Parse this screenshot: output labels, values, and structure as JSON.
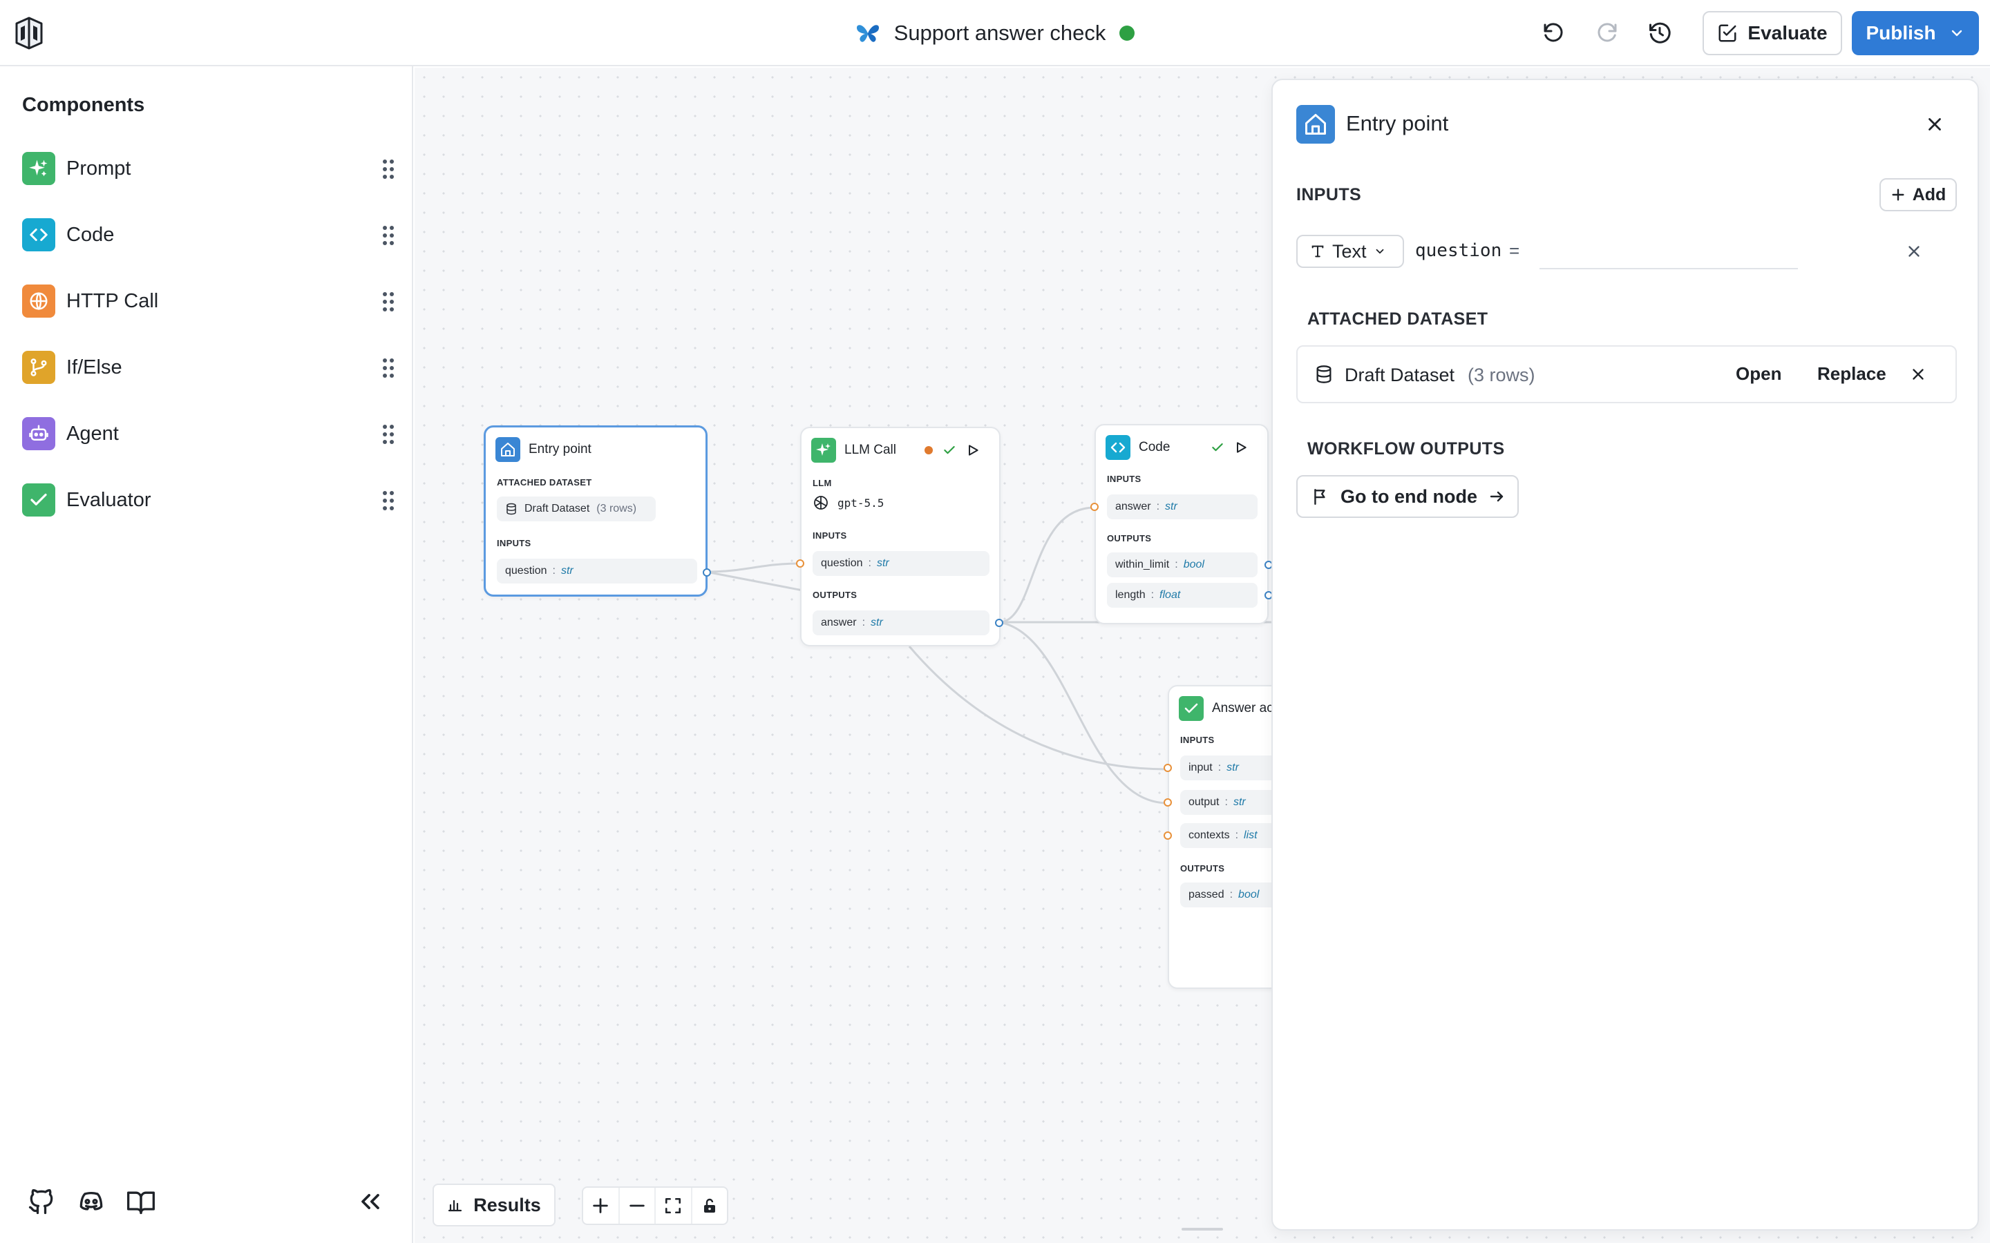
{
  "header": {
    "title": "Support answer check",
    "status_color": "#2ea043",
    "evaluate_label": "Evaluate",
    "publish_label": "Publish",
    "icons": [
      "undo-icon",
      "redo-icon",
      "history-icon",
      "logo-icon",
      "butterfly-icon"
    ]
  },
  "sidebar": {
    "title": "Components",
    "items": [
      {
        "label": "Prompt",
        "icon": "sparkles-icon",
        "color": "#3fb56b"
      },
      {
        "label": "Code",
        "icon": "code-icon",
        "color": "#17a9d1"
      },
      {
        "label": "HTTP Call",
        "icon": "globe-icon",
        "color": "#f08a3c"
      },
      {
        "label": "If/Else",
        "icon": "branch-icon",
        "color": "#e0a42a"
      },
      {
        "label": "Agent",
        "icon": "bot-icon",
        "color": "#8f6ee0"
      },
      {
        "label": "Evaluator",
        "icon": "check-icon",
        "color": "#3fb56b"
      }
    ],
    "footer_icons": [
      "github-icon",
      "discord-icon",
      "book-icon",
      "collapse-icon"
    ]
  },
  "canvas": {
    "nodes": {
      "entry": {
        "title": "Entry point",
        "dataset_label": "ATTACHED DATASET",
        "dataset_name": "Draft Dataset",
        "dataset_rows": "(3 rows)",
        "inputs_label": "INPUTS",
        "input_name": "question",
        "input_type": "str"
      },
      "llm": {
        "title": "LLM Call",
        "llm_label": "LLM",
        "model": "gpt-5.5",
        "inputs_label": "INPUTS",
        "input_name": "question",
        "input_type": "str",
        "outputs_label": "OUTPUTS",
        "output_name": "answer",
        "output_type": "str"
      },
      "code": {
        "title": "Code",
        "inputs_label": "INPUTS",
        "input_name": "answer",
        "input_type": "str",
        "outputs_label": "OUTPUTS",
        "outputs": [
          {
            "name": "within_limit",
            "type": "bool"
          },
          {
            "name": "length",
            "type": "float"
          }
        ]
      },
      "evaluator": {
        "title": "Answer ac",
        "inputs_label": "INPUTS",
        "inputs": [
          {
            "name": "input",
            "type": "str"
          },
          {
            "name": "output",
            "type": "str"
          },
          {
            "name": "contexts",
            "type": "list"
          }
        ],
        "outputs_label": "OUTPUTS",
        "output_name": "passed",
        "output_type": "bool"
      }
    },
    "results_label": "Results",
    "toolbar_icons": [
      "zoom-in-icon",
      "zoom-out-icon",
      "fit-view-icon",
      "lock-icon"
    ]
  },
  "panel": {
    "title": "Entry point",
    "inputs_label": "INPUTS",
    "add_label": "Add",
    "type_select": "Text",
    "var_name": "question",
    "equals": "=",
    "var_value": "",
    "dataset_section": "ATTACHED DATASET",
    "dataset_name": "Draft Dataset",
    "dataset_rows": "(3 rows)",
    "open_label": "Open",
    "replace_label": "Replace",
    "outputs_section": "WORKFLOW OUTPUTS",
    "end_node_label": "Go to end node"
  }
}
